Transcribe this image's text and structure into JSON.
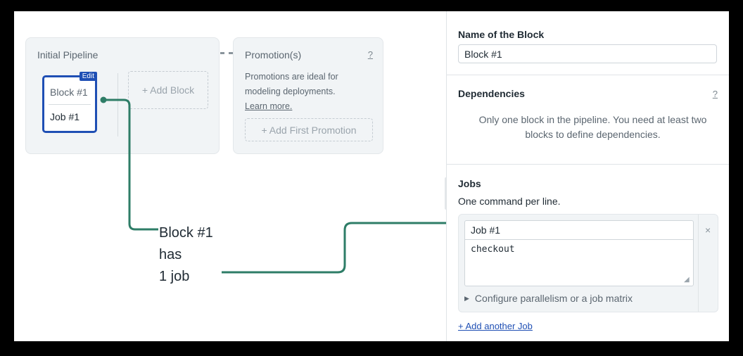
{
  "canvas": {
    "pipeline": {
      "title": "Initial Pipeline",
      "block": {
        "name": "Block #1",
        "job": "Job #1",
        "edit_label": "Edit"
      },
      "add_block_label": "+ Add Block"
    },
    "promotions": {
      "title": "Promotion(s)",
      "help_label": "?",
      "desc_line1": "Promotions are ideal for",
      "desc_line2": "modeling deployments.",
      "learn_more": "Learn more.",
      "add_label": "+ Add First Promotion"
    },
    "annotation": {
      "line1": "Block #1",
      "line2": "has",
      "line3": "1 job"
    }
  },
  "panel": {
    "name_section": {
      "title": "Name of the Block",
      "value": "Block #1"
    },
    "dependencies": {
      "title": "Dependencies",
      "help_label": "?",
      "text": "Only one block in the pipeline. You need at least two blocks to define dependencies."
    },
    "jobs": {
      "title": "Jobs",
      "subtitle": "One command per line.",
      "items": [
        {
          "name": "Job #1",
          "commands": "checkout",
          "remove_label": "×"
        }
      ],
      "parallelism_label": "Configure parallelism or a job matrix",
      "add_job_label": "+ Add another Job"
    }
  },
  "colors": {
    "accent": "#1f4fb4",
    "annotation_line": "#2e7d67",
    "card_bg": "#f1f4f6"
  },
  "icons": [
    "help-icon",
    "close-icon",
    "resize-handle-icon",
    "disclosure-triangle-icon"
  ]
}
